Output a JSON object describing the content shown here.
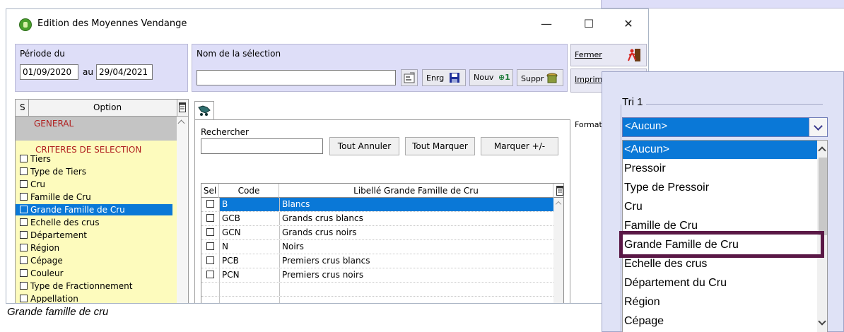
{
  "window": {
    "title": "Edition des Moyennes Vendange",
    "minimize": "—",
    "maximize": "☐",
    "close": "✕"
  },
  "periode": {
    "label": "Période du",
    "from": "01/09/2020",
    "au_label": "au",
    "to": "29/04/2021"
  },
  "selection": {
    "label": "Nom de la sélection",
    "value": "",
    "enrg": "Enrg",
    "nouv": "Nouv",
    "suppr": "Suppr"
  },
  "side_buttons": {
    "fermer": "Fermer",
    "imprimer": "Imprime",
    "format": "Format."
  },
  "options": {
    "col_s": "S",
    "col_option": "Option",
    "general": "GENERAL",
    "criteres": "CRITERES DE SELECTION",
    "items": [
      {
        "label": "Tiers"
      },
      {
        "label": "Type de Tiers"
      },
      {
        "label": "Cru"
      },
      {
        "label": "Famille de Cru"
      },
      {
        "label": "Grande Famille de Cru"
      },
      {
        "label": "Echelle des crus"
      },
      {
        "label": "Département"
      },
      {
        "label": "Région"
      },
      {
        "label": "Cépage"
      },
      {
        "label": "Couleur"
      },
      {
        "label": "Type de Fractionnement"
      },
      {
        "label": "Appellation"
      }
    ],
    "selected_index": 4
  },
  "search": {
    "label": "Rechercher",
    "value": "",
    "tout_annuler": "Tout Annuler",
    "tout_marquer": "Tout Marquer",
    "marquer_plus_minus": "Marquer +/-"
  },
  "grid": {
    "col_sel": "Sel",
    "col_code": "Code",
    "col_libelle": "Libellé Grande Famille de Cru",
    "rows": [
      {
        "code": "B",
        "libelle": "Blancs"
      },
      {
        "code": "GCB",
        "libelle": "Grands crus blancs"
      },
      {
        "code": "GCN",
        "libelle": "Grands crus noirs"
      },
      {
        "code": "N",
        "libelle": "Noirs"
      },
      {
        "code": "PCB",
        "libelle": "Premiers crus blancs"
      },
      {
        "code": "PCN",
        "libelle": "Premiers crus noirs"
      }
    ]
  },
  "caption": "Grande famille de cru",
  "tri": {
    "label": "Tri 1",
    "selected": "<Aucun>",
    "options": [
      "<Aucun>",
      "Pressoir",
      "Type de Pressoir",
      "Cru",
      "Famille de Cru",
      "Grande Famille de Cru",
      "Echelle des crus",
      "Département du Cru",
      "Région",
      "Cépage"
    ],
    "highlighted_option": "Grande Famille de Cru"
  },
  "colors": {
    "lavender": "#dedef8",
    "selection_blue": "#0a78d7",
    "option_yellow": "#fdfbbd",
    "highlight_box": "#5a1846"
  }
}
